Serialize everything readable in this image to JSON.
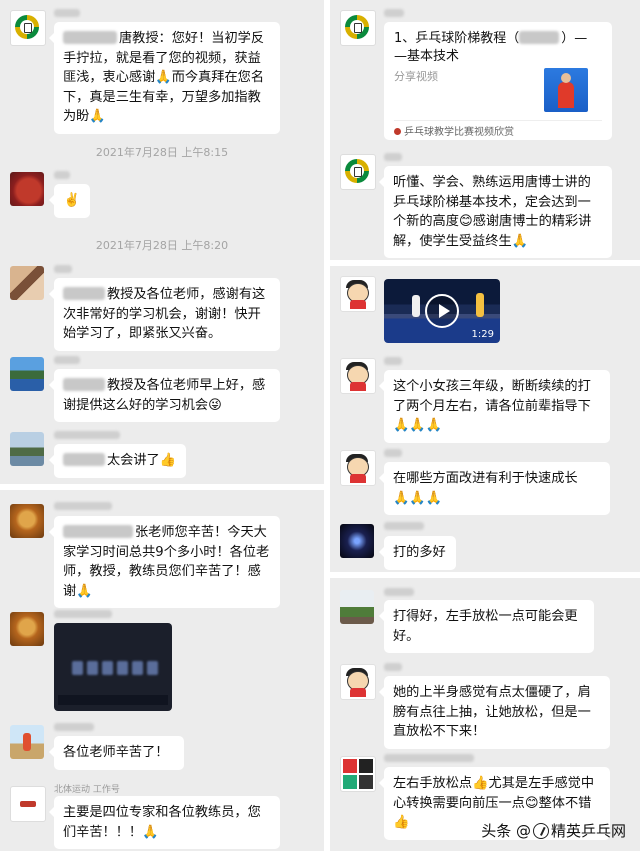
{
  "left_panel_1": {
    "msg1": {
      "text_after_blur": "唐教授：您好！当初学反手拧拉，就是看了您的视频，获益匪浅，衷心感谢",
      "text_tail": "而今真拜在您名下，真是三生有幸，万望多加指教为盼",
      "emoji_a": "🙏",
      "emoji_b": "🙏"
    },
    "ts1": "2021年7月28日 上午8:15",
    "msg2": {
      "emoji": "✌️"
    },
    "ts2": "2021年7月28日 上午8:20",
    "msg3": {
      "text": "教授及各位老师，感谢有这次非常好的学习机会，谢谢！快开始学习了，即紧张又兴奋。"
    },
    "msg4": {
      "text": "教授及各位老师早上好，感谢提供这么好的学习机会",
      "emoji": "😜"
    },
    "msg5": {
      "text": "太会讲了",
      "emoji": "👍"
    }
  },
  "left_panel_2": {
    "msg1": {
      "text": "张老师您辛苦！今天大家学习时间总共9个多小时！各位老师，教授，教练员您们辛苦了！感谢",
      "emoji": "🙏"
    },
    "msg3": {
      "text": "各位老师辛苦了！"
    },
    "msg4": {
      "sender": "北体运动",
      "sender_tag": "工作号",
      "text": "主要是四位专家和各位教练员，您们辛苦！！！",
      "emoji": "🙏"
    }
  },
  "right_panel_1": {
    "share": {
      "title_pre": "1、乒乓球阶梯教程（",
      "title_post": "）—",
      "title_line2": "—基本技术",
      "subtitle": "分享视频",
      "source": "乒乓球教学比赛视频欣赏"
    },
    "msg2": {
      "text": "听懂、学会、熟练运用唐博士讲的乒乓球阶梯基本技术，定会达到一个新的高度",
      "emoji": "😊",
      "text_tail": "感谢唐博士的精彩讲解，使学生受益终生",
      "emoji2": "🙏"
    }
  },
  "right_panel_2": {
    "video": {
      "duration": "1:29"
    },
    "msg2": {
      "text": "这个小女孩三年级，断断续续的打了两个月左右，请各位前辈指导下",
      "emojis": "🙏🙏🙏"
    },
    "msg3": {
      "text": "在哪些方面改进有利于快速成长",
      "emojis": "🙏🙏🙏"
    },
    "msg4": {
      "text": "打的多好"
    }
  },
  "right_panel_3": {
    "msg1": {
      "text": "打得好，左手放松一点可能会更好。"
    },
    "msg2": {
      "text": "她的上半身感觉有点太僵硬了，肩膀有点往上抽，让她放松，但是一直放松不下来！"
    },
    "msg3": {
      "text": "左右手放松点",
      "emoji": "👍",
      "text2": "尤其是左手感觉中心转换需要向前压一点",
      "emoji2": "😊",
      "text3": "整体不错",
      "emoji3": "👍"
    }
  },
  "watermark": {
    "prefix": "头条",
    "at": "@",
    "name": "精英乒乓网"
  },
  "colors": {
    "panel_bg": "#ececec",
    "bubble_bg": "#ffffff",
    "timestamp": "#a4a4a4"
  }
}
